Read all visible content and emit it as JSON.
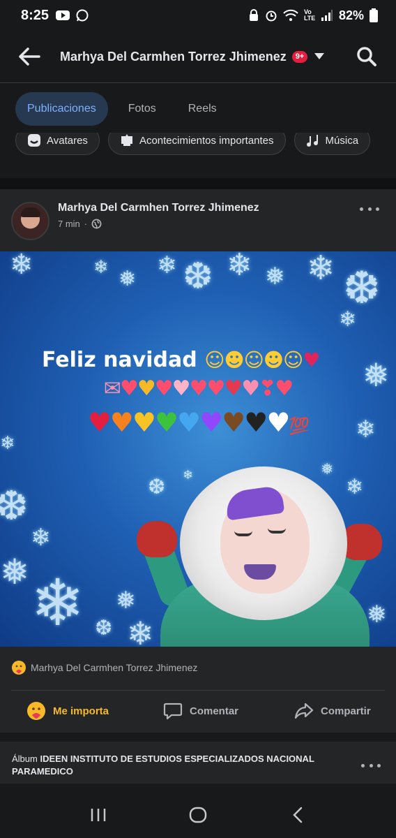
{
  "status_bar": {
    "time": "8:25",
    "battery": "82%",
    "network": "Vo LTE"
  },
  "header": {
    "title": "Marhya Del Carmhen Torrez Jhimenez",
    "badge": "9+"
  },
  "tabs": [
    {
      "label": "Publicaciones",
      "active": true
    },
    {
      "label": "Fotos",
      "active": false
    },
    {
      "label": "Reels",
      "active": false
    }
  ],
  "chips": [
    {
      "label": "Avatares",
      "icon": "avatar-icon"
    },
    {
      "label": "Acontecimientos importantes",
      "icon": "milestone-icon"
    },
    {
      "label": "Música",
      "icon": "music-icon"
    }
  ],
  "post": {
    "author": "Marhya Del Carmhen Torrez Jhimenez",
    "time": "7 min",
    "separator": "·",
    "privacy_icon": "globe-icon",
    "image": {
      "greeting": "Feliz navidad"
    },
    "reaction_summary": "Marhya Del Carmhen Torrez Jhimenez",
    "actions": {
      "like": "Me importa",
      "comment": "Comentar",
      "share": "Compartir"
    }
  },
  "next_post": {
    "prefix": "Álbum",
    "album_name": "IDEEN INSTITUTO DE ESTUDIOS ESPECIALIZADOS NACIONAL PARAMEDICO"
  },
  "colors": {
    "background": "#18191a",
    "card": "#242526",
    "tab_active_bg": "#263951",
    "tab_active_text": "#7fb0ff",
    "like_color": "#f7b928",
    "badge": "#e41e3f"
  }
}
